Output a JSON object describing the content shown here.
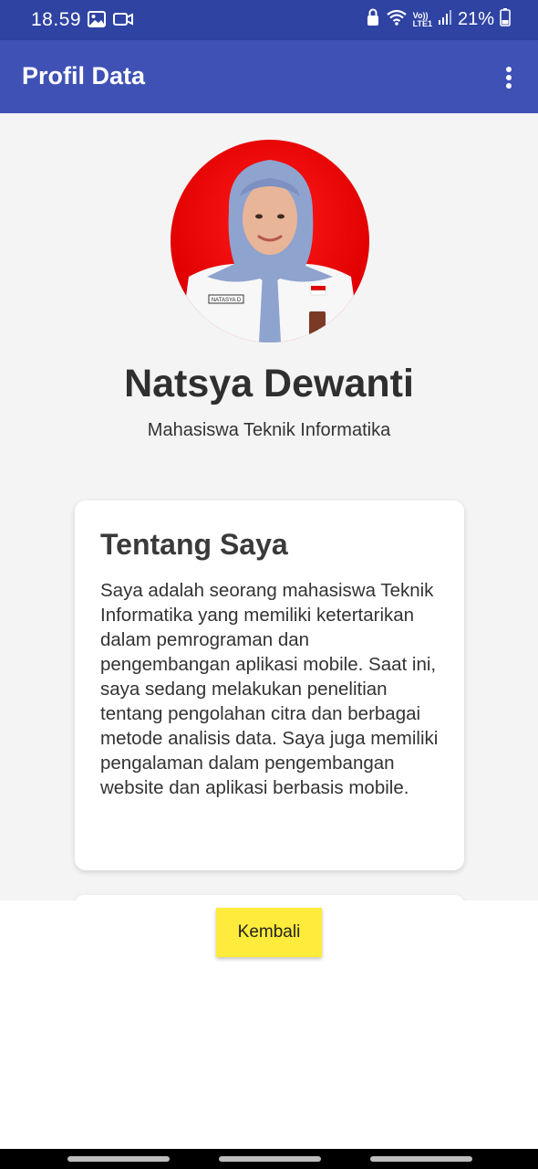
{
  "status_bar": {
    "time": "18.59",
    "battery_percent": "21%",
    "network_label_top": "Vo))",
    "network_label_bottom": "LTE1",
    "icons": [
      "image-icon",
      "video-icon",
      "lock-icon",
      "wifi-icon",
      "signal-icon",
      "battery-icon"
    ]
  },
  "app_bar": {
    "title": "Profil Data",
    "overflow_icon": "more-vert-icon"
  },
  "profile": {
    "name": "Natsya Dewanti",
    "subtitle": "Mahasiswa Teknik Informatika",
    "photo_name_tag": "NATASYA D"
  },
  "about": {
    "title": "Tentang Saya",
    "body": "Saya adalah seorang mahasiswa Teknik Informatika yang memiliki ketertarikan dalam pemrograman dan pengembangan aplikasi mobile. Saat ini, saya sedang melakukan penelitian tentang pengolahan citra dan berbagai metode analisis data. Saya juga memiliki pengalaman dalam pengembangan website dan aplikasi berbasis mobile."
  },
  "actions": {
    "back_label": "Kembali"
  },
  "colors": {
    "status_bar": "#2f43a3",
    "app_bar": "#3f51b5",
    "content_bg": "#f4f4f4",
    "button": "#ffeb3b",
    "avatar_bg": "#e00000"
  }
}
